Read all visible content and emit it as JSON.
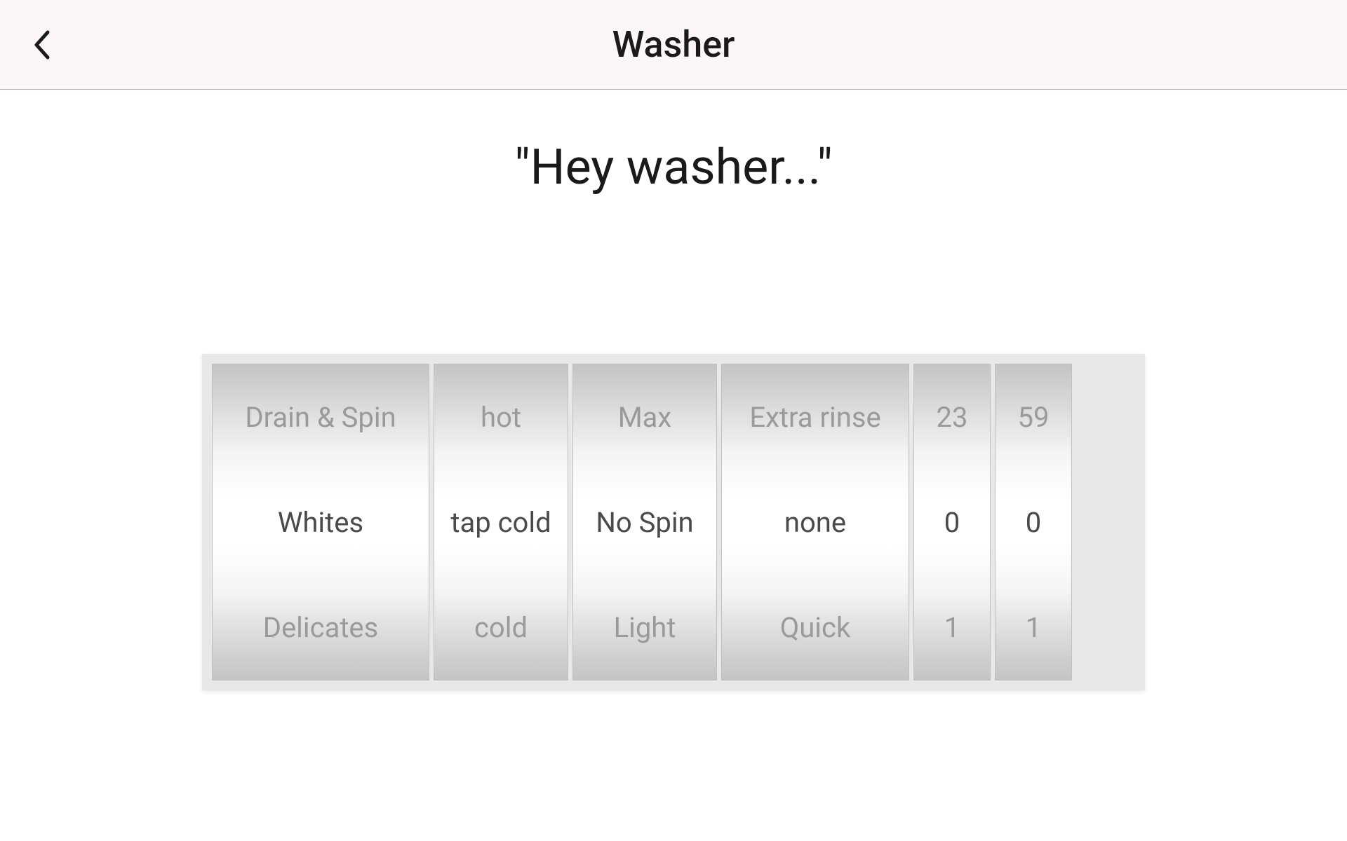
{
  "header": {
    "title": "Washer"
  },
  "main": {
    "prompt": "\"Hey washer...\""
  },
  "picker": {
    "wheels": [
      {
        "above": "Drain & Spin",
        "selected": "Whites",
        "below": "Delicates"
      },
      {
        "above": "hot",
        "selected": "tap cold",
        "below": "cold"
      },
      {
        "above": "Max",
        "selected": "No Spin",
        "below": "Light"
      },
      {
        "above": "Extra rinse",
        "selected": "none",
        "below": "Quick"
      },
      {
        "above": "23",
        "selected": "0",
        "below": "1"
      },
      {
        "above": "59",
        "selected": "0",
        "below": "1"
      }
    ]
  }
}
